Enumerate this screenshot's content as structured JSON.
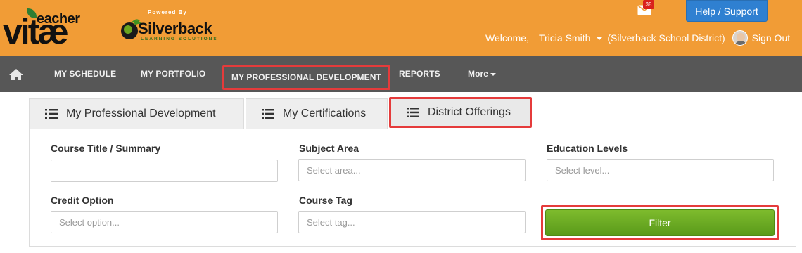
{
  "header": {
    "logo_teacher": "eacher",
    "logo_vitae": "vitæ",
    "powered_by": "Powered By",
    "silverback": "Silverback",
    "silverback_sub": "LEARNING SOLUTIONS",
    "mail_count": "38",
    "help_button": "Help / Support",
    "welcome": "Welcome,",
    "user_name": "Tricia Smith",
    "district": "(Silverback School District)",
    "sign_out": "Sign Out"
  },
  "nav": {
    "items": [
      {
        "label": "MY SCHEDULE"
      },
      {
        "label": "MY PORTFOLIO"
      },
      {
        "label": "MY PROFESSIONAL DEVELOPMENT"
      },
      {
        "label": "REPORTS"
      },
      {
        "label": "More"
      }
    ]
  },
  "tabs": [
    {
      "label": "My Professional Development"
    },
    {
      "label": "My Certifications"
    },
    {
      "label": "District Offerings"
    }
  ],
  "form": {
    "course_title_label": "Course Title / Summary",
    "course_title_value": "",
    "subject_area_label": "Subject Area",
    "subject_area_placeholder": "Select area...",
    "education_levels_label": "Education Levels",
    "education_levels_placeholder": "Select level...",
    "credit_option_label": "Credit Option",
    "credit_option_placeholder": "Select option...",
    "course_tag_label": "Course Tag",
    "course_tag_placeholder": "Select tag...",
    "filter_button": "Filter"
  },
  "colors": {
    "header_bg": "#f19c36",
    "nav_bg": "#575757",
    "help_button": "#2f80d1",
    "highlight": "#e53b3b",
    "filter_button": "#6aab22"
  }
}
